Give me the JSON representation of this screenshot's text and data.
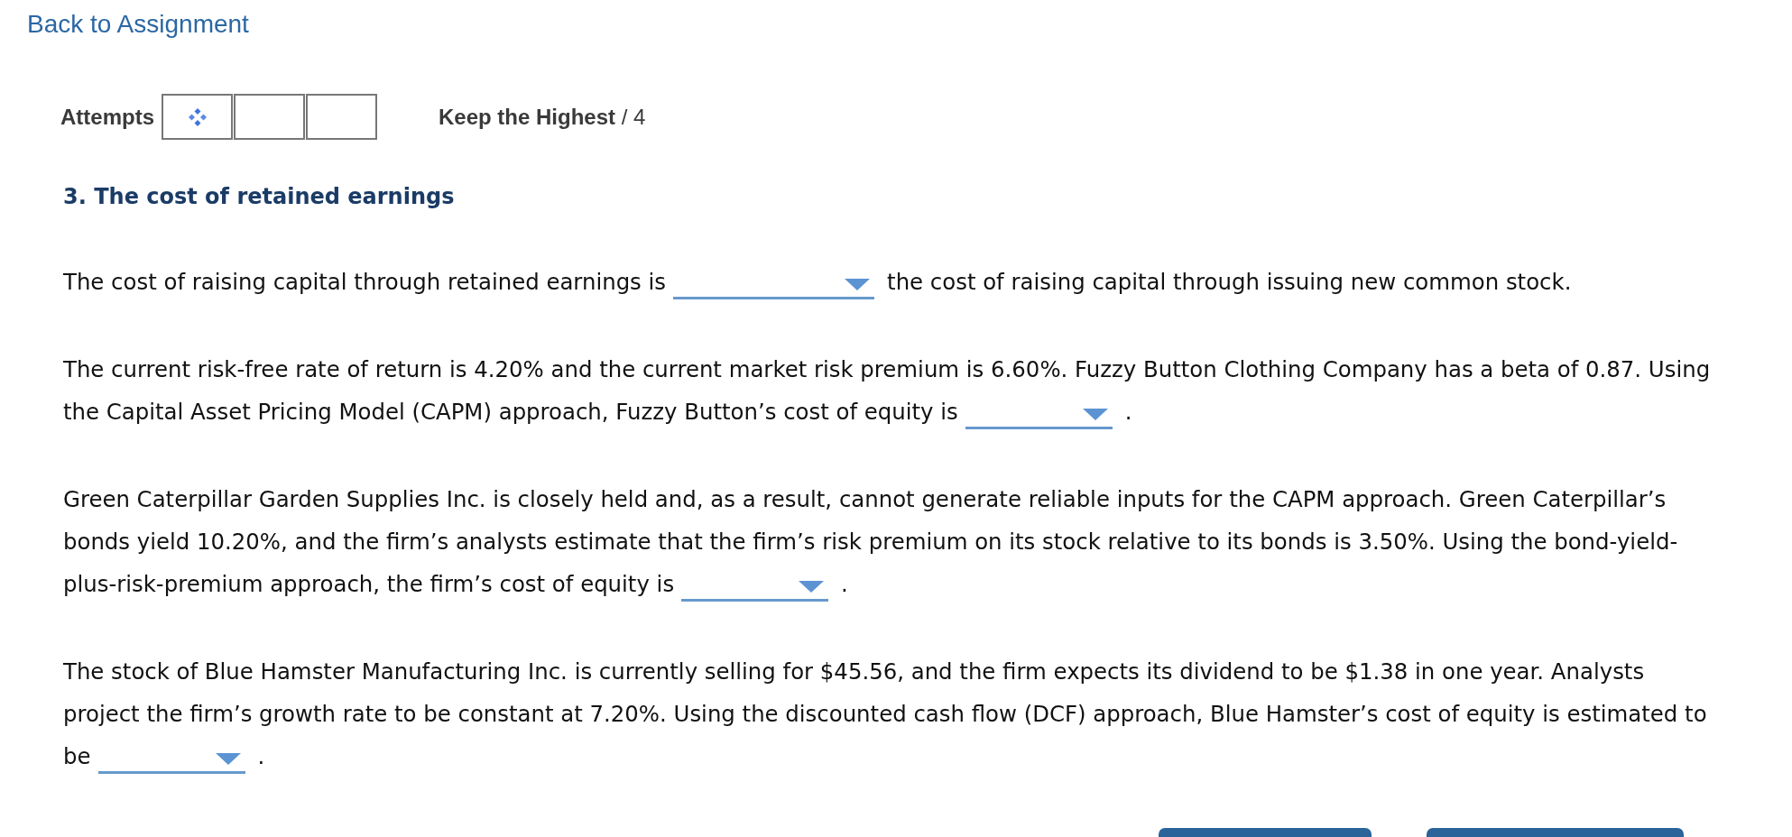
{
  "back_link": {
    "label": "Back to Assignment"
  },
  "attempts": {
    "label": "Attempts",
    "boxes": [
      {
        "in_progress": true
      },
      {
        "in_progress": false
      },
      {
        "in_progress": false
      }
    ],
    "policy": "**Keep the Highest** / 4"
  },
  "question": {
    "title": "3. The cost of retained earnings",
    "paragraphs": [
      {
        "lines": [
          {
            "parts": [
              {
                "kind": "text",
                "text": "The cost of raising capital through retained earnings is"
              },
              {
                "kind": "dropdown"
              },
              {
                "kind": "text",
                "text": "the cost of raising capital through issuing new common stock."
              }
            ]
          }
        ]
      },
      {
        "lines": [
          {
            "parts": [
              {
                "kind": "text",
                "text": "The current risk-free rate of return is 4.20% and the current market risk premium is 6.60%. Fuzzy Button Clothing Company has a beta of 0.87. Using"
              }
            ]
          },
          {
            "parts": [
              {
                "kind": "text",
                "text": "the Capital Asset Pricing Model (CAPM) approach, Fuzzy Button’s cost of equity is"
              },
              {
                "kind": "dropdown"
              },
              {
                "kind": "text",
                "text": "."
              }
            ]
          }
        ]
      },
      {
        "lines": [
          {
            "parts": [
              {
                "kind": "text",
                "text": "Green Caterpillar Garden Supplies Inc. is closely held and, as a result, cannot generate reliable inputs for the CAPM approach. Green Caterpillar’s"
              }
            ]
          },
          {
            "parts": [
              {
                "kind": "text",
                "text": "bonds yield 10.20%, and the firm’s analysts estimate that the firm’s risk premium on its stock relative to its bonds is 3.50%. Using the bond-yield-"
              }
            ]
          },
          {
            "parts": [
              {
                "kind": "text",
                "text": "plus-risk-premium approach, the firm’s cost of equity is"
              },
              {
                "kind": "dropdown"
              },
              {
                "kind": "text",
                "text": "."
              }
            ]
          }
        ]
      },
      {
        "lines": [
          {
            "parts": [
              {
                "kind": "text",
                "text": "The stock of Blue Hamster Manufacturing Inc. is currently selling for $45.56, and the firm expects its dividend to be $1.38 in one year. Analysts"
              }
            ]
          },
          {
            "parts": [
              {
                "kind": "text",
                "text": "project the firm’s growth rate to be constant at 7.20%. Using the discounted cash flow (DCF) approach, Blue Hamster’s cost of equity is estimated to"
              }
            ]
          },
          {
            "parts": [
              {
                "kind": "text",
                "text": "be"
              },
              {
                "kind": "dropdown"
              },
              {
                "kind": "text",
                "text": "."
              }
            ]
          }
        ]
      }
    ]
  }
}
